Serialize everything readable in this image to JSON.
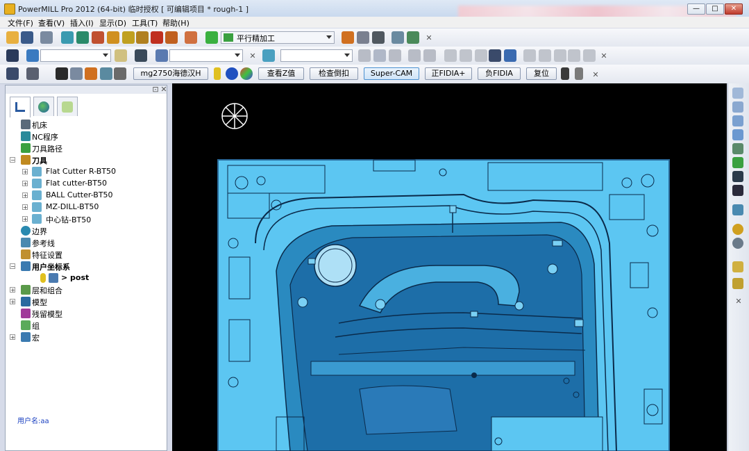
{
  "window": {
    "title": "PowerMILL Pro 2012 (64-bit) 临时授权    [ 可编辑项目 * rough-1 ]",
    "minimize": "—",
    "maximize": "□",
    "close": "✕"
  },
  "menu": [
    "文件(F)",
    "查看(V)",
    "插入(I)",
    "显示(D)",
    "工具(T)",
    "帮助(H)"
  ],
  "toolbar1": {
    "strategy_label": "平行精加工"
  },
  "toolbar3": {
    "buttons": [
      "mg2750海德汉H",
      "查看Z值",
      "检查倒扣",
      "Super-CAM",
      "正FIDIA+",
      "负FIDIA",
      "复位"
    ]
  },
  "explorer": {
    "tree": [
      {
        "label": "机床",
        "color": "#5a6a7a"
      },
      {
        "label": "NC程序",
        "color": "#2a8a9a"
      },
      {
        "label": "刀具路径",
        "color": "#3aa040"
      },
      {
        "label": "刀具",
        "color": "#c08a20",
        "bold": true
      },
      {
        "label": "Flat Cutter R-BT50",
        "color": "#6ab0d0"
      },
      {
        "label": "Flat cutter-BT50",
        "color": "#6ab0d0"
      },
      {
        "label": "BALL Cutter-BT50",
        "color": "#6ab0d0"
      },
      {
        "label": "MZ-DILL-BT50",
        "color": "#6ab0d0"
      },
      {
        "label": "中心钻-BT50",
        "color": "#6ab0d0"
      },
      {
        "label": "边界",
        "color": "#2a8ab0"
      },
      {
        "label": "参考线",
        "color": "#4a8ab0"
      },
      {
        "label": "特征设置",
        "color": "#c09030"
      },
      {
        "label": "用户坐标系",
        "color": "#3a7ab0",
        "bold": true
      },
      {
        "label": "> post",
        "color": "#c0a020",
        "bold": true
      },
      {
        "label": "层和组合",
        "color": "#5a9a4a"
      },
      {
        "label": "模型",
        "color": "#2a6aa0"
      },
      {
        "label": "残留模型",
        "color": "#a03a9a"
      },
      {
        "label": "组",
        "color": "#5aaa5a"
      },
      {
        "label": "宏",
        "color": "#3a7ab0"
      }
    ],
    "user_label": "用户名:aa"
  },
  "colors": {
    "viewport_bg": "#000000",
    "part_fill": "#5cc6f2",
    "part_line": "#0a2a4a"
  }
}
